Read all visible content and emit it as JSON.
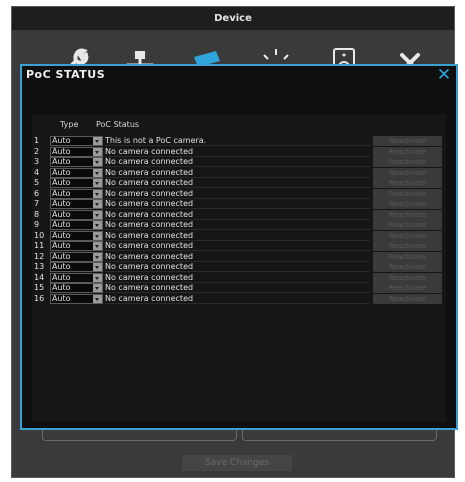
{
  "window": {
    "title": "Device"
  },
  "toolbar": {
    "icons": [
      "wrench-icon",
      "network-icon",
      "camera-icon",
      "light-icon",
      "speaker-icon",
      "close-x-icon"
    ]
  },
  "modal": {
    "title": "PoC STATUS",
    "close_label": "✕",
    "columns": {
      "type": "Type",
      "status": "PoC Status"
    },
    "rows": [
      {
        "num": "1",
        "type": "Auto",
        "status": "This is not a PoC camera.",
        "action": "Reactivate"
      },
      {
        "num": "2",
        "type": "Auto",
        "status": "No camera connected",
        "action": "Reactivate"
      },
      {
        "num": "3",
        "type": "Auto",
        "status": "No camera connected",
        "action": "Reactivate"
      },
      {
        "num": "4",
        "type": "Auto",
        "status": "No camera connected",
        "action": "Reactivate"
      },
      {
        "num": "5",
        "type": "Auto",
        "status": "No camera connected",
        "action": "Reactivate"
      },
      {
        "num": "6",
        "type": "Auto",
        "status": "No camera connected",
        "action": "Reactivate"
      },
      {
        "num": "7",
        "type": "Auto",
        "status": "No camera connected",
        "action": "Reactivate"
      },
      {
        "num": "8",
        "type": "Auto",
        "status": "No camera connected",
        "action": "Reactivate"
      },
      {
        "num": "9",
        "type": "Auto",
        "status": "No camera connected",
        "action": "Reactivate"
      },
      {
        "num": "10",
        "type": "Auto",
        "status": "No camera connected",
        "action": "Reactivate"
      },
      {
        "num": "11",
        "type": "Auto",
        "status": "No camera connected",
        "action": "Reactivate"
      },
      {
        "num": "12",
        "type": "Auto",
        "status": "No camera connected",
        "action": "Reactivate"
      },
      {
        "num": "13",
        "type": "Auto",
        "status": "No camera connected",
        "action": "Reactivate"
      },
      {
        "num": "14",
        "type": "Auto",
        "status": "No camera connected",
        "action": "Reactivate"
      },
      {
        "num": "15",
        "type": "Auto",
        "status": "No camera connected",
        "action": "Reactivate"
      },
      {
        "num": "16",
        "type": "Auto",
        "status": "No camera connected",
        "action": "Reactivate"
      }
    ]
  },
  "footer": {
    "save_label": "Save Changes"
  },
  "colors": {
    "accent": "#3aa0d0",
    "camera_icon": "#2ea5dc"
  }
}
